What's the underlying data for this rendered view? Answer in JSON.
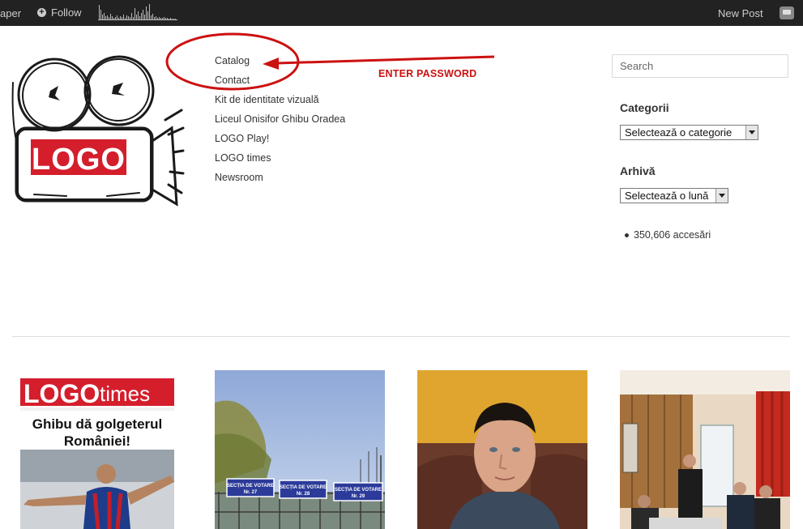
{
  "adminbar": {
    "site_label": "aper",
    "follow_label": "Follow",
    "new_post_label": "New Post"
  },
  "logo": {
    "text": "LOGO"
  },
  "menu": {
    "items": [
      "Catalog",
      "Contact",
      "Kit de identitate vizuală",
      "Liceul Onisifor Ghibu Oradea",
      "LOGO Play!",
      "LOGO times",
      "Newsroom"
    ]
  },
  "annotation": {
    "text": "ENTER PASSWORD",
    "color": "#cc1111"
  },
  "sidebar": {
    "search_placeholder": "Search",
    "categories_title": "Categorii",
    "categories_selected": "Selectează o categorie",
    "archive_title": "Arhivă",
    "archive_selected": "Selectează o lună",
    "hits": "350,606 accesări"
  },
  "posts": {
    "logo_times": {
      "masthead_logo": "LOGO",
      "masthead_times": "times",
      "headline_line1": "Ghibu dă golgeterul",
      "headline_line2": "României!"
    },
    "voting": {
      "sign1_line1": "SECȚIA DE VOTARE",
      "sign1_line2": "Nr. 27",
      "sign2_line1": "SECȚIA DE VOTARE",
      "sign2_line2": "Nr. 28",
      "sign3_line1": "SECȚIA DE VOTARE",
      "sign3_line2": "Nr. 29"
    }
  }
}
